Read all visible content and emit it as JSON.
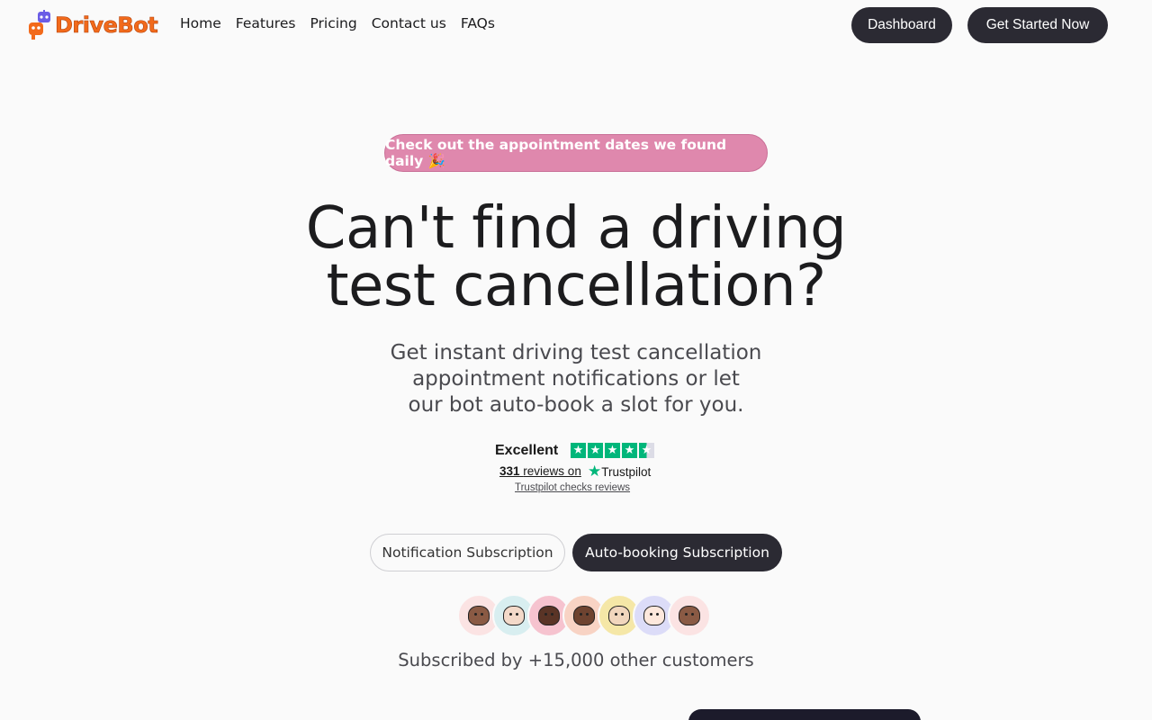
{
  "brand": {
    "name": "DriveBot",
    "accent": "#f26a1b",
    "robot_color": "#6b5de6"
  },
  "nav": {
    "links": [
      "Home",
      "Features",
      "Pricing",
      "Contact us",
      "FAQs"
    ],
    "dashboard_label": "Dashboard",
    "get_started_label": "Get Started Now"
  },
  "hero": {
    "pill": "Check out the appointment dates we found daily 🎉",
    "headline_line1": "Can't find a driving",
    "headline_line2": "test cancellation?",
    "sub_line1": "Get instant driving test cancellation",
    "sub_line2": "appointment notifications or let",
    "sub_line3": "our bot auto-book a slot for you."
  },
  "trustpilot": {
    "rating_word": "Excellent",
    "review_count": "331",
    "reviews_on": "reviews on",
    "brand": "Trustpilot",
    "checks_link": "Trustpilot checks reviews",
    "star_color": "#00b67a",
    "stars": 4.5
  },
  "plans": {
    "notification_label": "Notification Subscription",
    "autobooking_label": "Auto-booking Subscription",
    "selected": "Auto-booking Subscription"
  },
  "social_proof": {
    "avatars": [
      {
        "bg": "#fbe3e3",
        "skin": "#8a5a44"
      },
      {
        "bg": "#d8eef0",
        "skin": "#f3d9c9"
      },
      {
        "bg": "#f6c3cf",
        "skin": "#5a3426"
      },
      {
        "bg": "#f8d3c4",
        "skin": "#6e4330"
      },
      {
        "bg": "#f5e7a7",
        "skin": "#f1d6bd"
      },
      {
        "bg": "#dcdcf8",
        "skin": "#fde8dc"
      },
      {
        "bg": "#fbe3e3",
        "skin": "#8a5a44"
      }
    ],
    "text": "Subscribed by +15,000 other customers"
  }
}
